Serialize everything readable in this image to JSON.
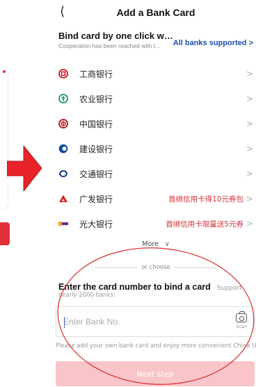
{
  "header": {
    "back_icon": "back-chevron",
    "title": "Add a Bank Card"
  },
  "one_click": {
    "title": "Bind card by one click with...",
    "subtitle": "Cooperation has been reached with t...",
    "link": "All banks supported",
    "link_icon": "chevron-right",
    "link_color": "#1d4fb0"
  },
  "banks": [
    {
      "name": "工商银行",
      "icon": "icbc-logo",
      "color": "#c7000b",
      "promo": ""
    },
    {
      "name": "农业银行",
      "icon": "abc-logo",
      "color": "#0a8a5a",
      "promo": ""
    },
    {
      "name": "中国银行",
      "icon": "boc-logo",
      "color": "#b3151c",
      "promo": ""
    },
    {
      "name": "建设银行",
      "icon": "ccb-logo",
      "color": "#0b4ba1",
      "promo": ""
    },
    {
      "name": "交通银行",
      "icon": "bocom-logo",
      "color": "#1a3f8f",
      "promo": ""
    },
    {
      "name": "广发银行",
      "icon": "cgb-logo",
      "color": "#d41f26",
      "promo": "首绑信用卡得10元券包"
    },
    {
      "name": "光大银行",
      "icon": "ceb-logo",
      "color": "#6a2c8f",
      "promo": "首绑信用卡限量送5元券"
    }
  ],
  "more": {
    "label": "More",
    "icon": "chevron-down"
  },
  "or_choose": "or choose",
  "manual_entry": {
    "title": "Enter the card number to bind a card",
    "support": "Support",
    "subtitle": "nearly 2000 banks:",
    "placeholder": "Enter Bank No.",
    "scan_label": "Scan",
    "scan_icon": "camera"
  },
  "note": "Please add your own bank card and enjoy more convenient China Uni",
  "next_button": {
    "label": "Next step",
    "color": "#f9c5c8"
  },
  "accent_red": "#e0303a"
}
